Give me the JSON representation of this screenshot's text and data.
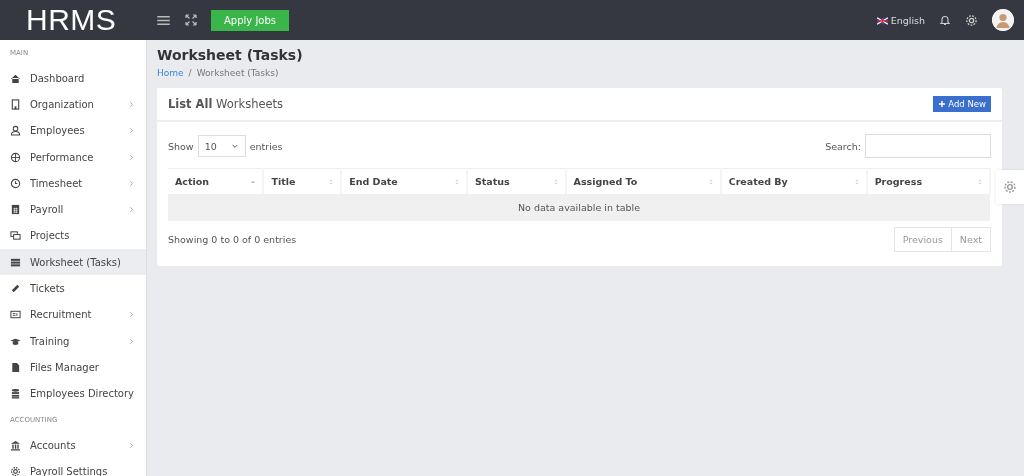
{
  "topbar": {
    "logo": "HRMS",
    "apply_button": "Apply Jobs",
    "language": "English"
  },
  "sidebar": {
    "sections": [
      {
        "heading": "MAIN",
        "items": [
          {
            "label": "Dashboard",
            "submenu": false,
            "selected": false
          },
          {
            "label": "Organization",
            "submenu": true,
            "selected": false
          },
          {
            "label": "Employees",
            "submenu": true,
            "selected": false
          },
          {
            "label": "Performance",
            "submenu": true,
            "selected": false
          },
          {
            "label": "Timesheet",
            "submenu": true,
            "selected": false
          },
          {
            "label": "Payroll",
            "submenu": true,
            "selected": false
          },
          {
            "label": "Projects",
            "submenu": false,
            "selected": false
          },
          {
            "label": "Worksheet (Tasks)",
            "submenu": false,
            "selected": true
          },
          {
            "label": "Tickets",
            "submenu": false,
            "selected": false
          },
          {
            "label": "Recruitment",
            "submenu": true,
            "selected": false
          },
          {
            "label": "Training",
            "submenu": true,
            "selected": false
          },
          {
            "label": "Files Manager",
            "submenu": false,
            "selected": false
          },
          {
            "label": "Employees Directory",
            "submenu": false,
            "selected": false
          }
        ]
      },
      {
        "heading": "ACCOUNTING",
        "items": [
          {
            "label": "Accounts",
            "submenu": true,
            "selected": false
          },
          {
            "label": "Payroll Settings",
            "submenu": false,
            "selected": false
          }
        ]
      }
    ]
  },
  "page": {
    "title": "Worksheet (Tasks)",
    "breadcrumb": [
      "Home",
      "Worksheet (Tasks)"
    ],
    "breadcrumb_separator": "/"
  },
  "panel": {
    "title": "**List All** Worksheets",
    "add_button": "Add New",
    "length": {
      "before": "Show",
      "value": "10",
      "after": "entries"
    },
    "search": {
      "label": "Search:"
    },
    "table": {
      "columns": [
        {
          "label": "Action",
          "sorted": true
        },
        {
          "label": "Title",
          "sorted": false
        },
        {
          "label": "End Date",
          "sorted": false
        },
        {
          "label": "Status",
          "sorted": false
        },
        {
          "label": "Assigned To",
          "sorted": false
        },
        {
          "label": "Created By",
          "sorted": false
        },
        {
          "label": "Progress",
          "sorted": false
        }
      ],
      "empty": "No data available in table"
    },
    "info": "Showing 0 to 0 of 0 entries",
    "pagination": [
      {
        "label": "Previous",
        "disabled": true
      },
      {
        "label": "Next",
        "disabled": true
      }
    ]
  }
}
